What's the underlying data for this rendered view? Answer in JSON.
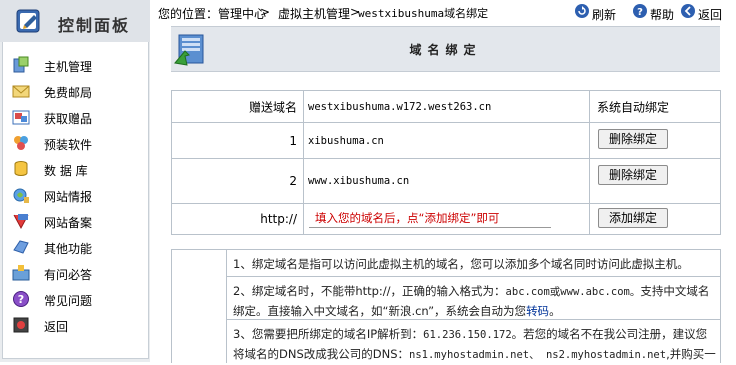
{
  "sidebar": {
    "title": "控制面板",
    "items": [
      {
        "label": "主机管理",
        "icon": "server-icon"
      },
      {
        "label": "免费邮局",
        "icon": "mail-icon"
      },
      {
        "label": "获取赠品",
        "icon": "gift-icon"
      },
      {
        "label": "预装软件",
        "icon": "software-icon"
      },
      {
        "label": "数 据 库",
        "icon": "database-icon"
      },
      {
        "label": "网站情报",
        "icon": "report-icon"
      },
      {
        "label": "网站备案",
        "icon": "record-icon"
      },
      {
        "label": "其他功能",
        "icon": "other-icon"
      },
      {
        "label": "有问必答",
        "icon": "qa-icon"
      },
      {
        "label": "常见问题",
        "icon": "faq-icon"
      },
      {
        "label": "返回",
        "icon": "back-icon"
      }
    ]
  },
  "breadcrumb": {
    "prefix": "您的位置：管理中心",
    "sep": ">",
    "p2": "虚拟主机管理",
    "sep2": ">",
    "p3": "westxibushuma域名绑定"
  },
  "toolbar": {
    "refresh": "刷新",
    "help": "帮助",
    "back": "返回"
  },
  "section_title": "域名绑定",
  "bindings": {
    "gift_label": "赠送域名",
    "gift_domain": "westxibushuma.w172.west263.cn",
    "gift_status": "系统自动绑定",
    "rows": [
      {
        "index": "1",
        "domain": "xibushuma.cn",
        "button": "删除绑定"
      },
      {
        "index": "2",
        "domain": "www.xibushuma.cn",
        "button": "删除绑定"
      }
    ],
    "new_prefix": "http://",
    "new_value": "填入您的域名后，点“添加绑定”即可",
    "add_button": "添加绑定"
  },
  "notes": {
    "n1": "1、绑定域名是指可以访问此虚拟主机的域名，您可以添加多个域名同时访问此虚拟主机。",
    "n2_a": "2、绑定域名时，不能带http://，正确的输入格式为：",
    "n2_b": "abc.com或www.abc.com。",
    "n2_c": "支持中文域名绑定。直接输入中文域名，如“新浪.cn”，系统会自动为您",
    "n2_link": "转码",
    "n2_d": "。",
    "n3_a": "3、您需要把所绑定的域名IP解析到：",
    "n3_ip": "61.236.150.172",
    "n3_b": "。若您的域名不在我公司注册，建议您将域名的DNS改成我公司的DNS：",
    "n3_dns": "ns1.myhostadmin.net、 ns2.myhostadmin.net",
    "n3_c": ",并购买一"
  }
}
